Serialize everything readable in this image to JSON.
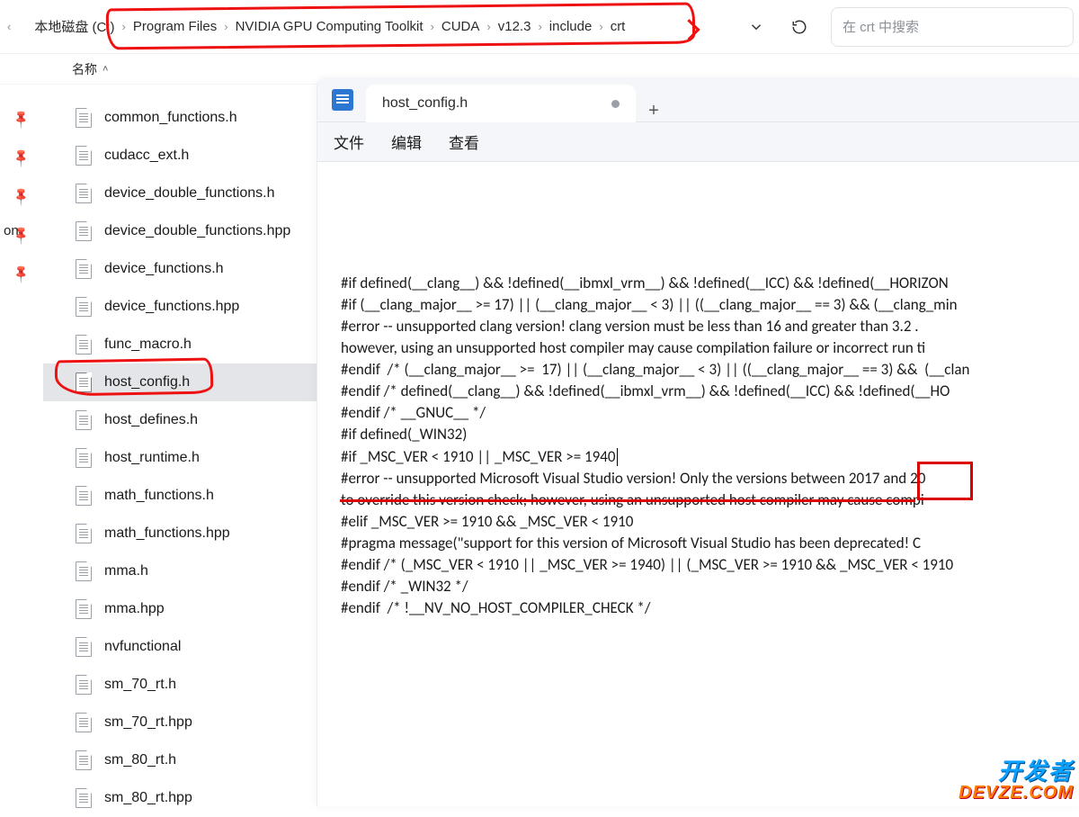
{
  "breadcrumb": {
    "items": [
      {
        "label": "本地磁盘 (C:)"
      },
      {
        "label": "Program Files"
      },
      {
        "label": "NVIDIA GPU Computing Toolkit"
      },
      {
        "label": "CUDA"
      },
      {
        "label": "v12.3"
      },
      {
        "label": "include"
      },
      {
        "label": "crt"
      }
    ]
  },
  "search": {
    "placeholder": "在 crt 中搜索"
  },
  "columns": {
    "name": "名称",
    "sort_asc": "ˆ"
  },
  "sidebar_bottom_label": "on",
  "files": [
    {
      "name": "common_functions.h"
    },
    {
      "name": "cudacc_ext.h"
    },
    {
      "name": "device_double_functions.h"
    },
    {
      "name": "device_double_functions.hpp"
    },
    {
      "name": "device_functions.h"
    },
    {
      "name": "device_functions.hpp"
    },
    {
      "name": "func_macro.h"
    },
    {
      "name": "host_config.h",
      "selected": true
    },
    {
      "name": "host_defines.h"
    },
    {
      "name": "host_runtime.h"
    },
    {
      "name": "math_functions.h"
    },
    {
      "name": "math_functions.hpp"
    },
    {
      "name": "mma.h"
    },
    {
      "name": "mma.hpp"
    },
    {
      "name": "nvfunctional"
    },
    {
      "name": "sm_70_rt.h"
    },
    {
      "name": "sm_70_rt.hpp"
    },
    {
      "name": "sm_80_rt.h"
    },
    {
      "name": "sm_80_rt.hpp"
    }
  ],
  "editor": {
    "tab_title": "host_config.h",
    "new_tab": "+",
    "menu": {
      "file": "文件",
      "edit": "编辑",
      "view": "查看"
    },
    "code_lines": [
      "#if defined(__clang__) && !defined(__ibmxl_vrm__) && !defined(__ICC) && !defined(__HORIZON",
      "",
      "#if (__clang_major__ >= 17) || (__clang_major__ < 3) || ((__clang_major__ == 3) && (__clang_min",
      "#error -- unsupported clang version! clang version must be less than 16 and greater than 3.2 .",
      "however, using an unsupported host compiler may cause compilation failure or incorrect run ti",
      "",
      "#endif  /* (__clang_major__ >=  17) || (__clang_major__ < 3) || ((__clang_major__ == 3) &&  (__clan",
      "",
      "#endif /* defined(__clang__) && !defined(__ibmxl_vrm__) && !defined(__ICC) && !defined(__HO",
      "",
      "",
      "#endif /* __GNUC__ */",
      "",
      "#if defined(_WIN32)",
      "",
      "#if _MSC_VER < 1910 || _MSC_VER >= 1940",
      "",
      "#error -- unsupported Microsoft Visual Studio version! Only the versions between 2017 and 20",
      "to override this version check; however, using an unsupported host compiler may cause compi",
      "",
      "#elif _MSC_VER >= 1910 && _MSC_VER < 1910",
      "",
      "#pragma message(\"support for this version of Microsoft Visual Studio has been deprecated! C",
      "",
      "#endif /* (_MSC_VER < 1910 || _MSC_VER >= 1940) || (_MSC_VER >= 1910 && _MSC_VER < 1910",
      "",
      "#endif /* _WIN32 */",
      "#endif  /* !__NV_NO_HOST_COMPILER_CHECK */"
    ]
  },
  "watermark": {
    "line1": "开发者",
    "line2": "DEVZE.COM"
  }
}
